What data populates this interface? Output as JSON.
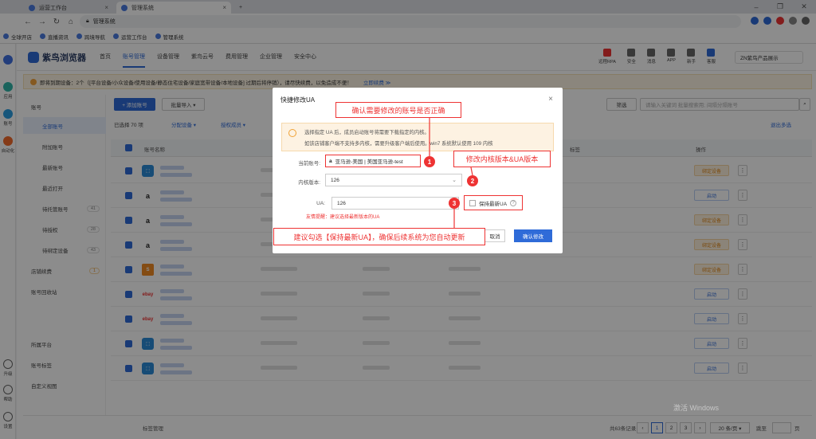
{
  "browser": {
    "tabs": [
      {
        "label": "运营工作台"
      },
      {
        "label": "管理系统"
      }
    ],
    "address": "管理系统",
    "bookmarks": [
      "全球开店",
      "直播资讯",
      "跨境导航",
      "运营工作台",
      "管理系统"
    ]
  },
  "leftrail": {
    "items": [
      "应用",
      "账号",
      "自动化",
      "升级",
      "帮助",
      "设置"
    ]
  },
  "app": {
    "brand": "紫鸟浏览器",
    "nav": [
      "首页",
      "账号管理",
      "设备管理",
      "紫鸟云号",
      "费用管理",
      "企业管理",
      "安全中心"
    ],
    "header_icons": [
      "远程RPA",
      "安全",
      "消息",
      "APP",
      "新手",
      "客服"
    ],
    "user": "ZN紫鸟产品展示"
  },
  "notice": {
    "text": "即将到期设备：2个（[平台设备/小众设备/使用设备/静态住宅设备/家庭宽带设备/本地设备] 过期后将停销），请尽快续费，以免造成不便！",
    "link": "立即续费 ≫"
  },
  "sidebar": {
    "section": "账号",
    "items": [
      {
        "label": "全部账号",
        "count": ""
      },
      {
        "label": "附加账号",
        "count": ""
      },
      {
        "label": "最新账号",
        "count": ""
      },
      {
        "label": "最近打开",
        "count": ""
      },
      {
        "label": "待托管账号",
        "count": "41"
      },
      {
        "label": "待授权",
        "count": "28"
      },
      {
        "label": "待绑定设备",
        "count": "43"
      }
    ],
    "extra": [
      "店铺续费",
      "账号回收站"
    ],
    "badge": "1",
    "bottom": [
      "所属平台",
      "账号标签",
      "自定义视图"
    ]
  },
  "main": {
    "add_btn": "+ 添加账号",
    "import_btn": "批量导入 ▾",
    "search_scope": "筛选",
    "search_placeholder": "请输入关键词 批量搜索用; 间隔分隔账号",
    "selected": "已选择 70 项",
    "dist_device": "分配设备 ▾",
    "auth_member": "授权成员 ▾",
    "exit_multi": "退出多选",
    "columns": [
      "账号名称",
      "标签",
      "操作"
    ],
    "rows": [
      {
        "icon": "⬚",
        "action": "绑定设备"
      },
      {
        "icon": "a",
        "action": "启动"
      },
      {
        "icon": "a",
        "action": "绑定设备"
      },
      {
        "icon": "a",
        "action": "绑定设备"
      },
      {
        "icon": "S",
        "action": "绑定设备"
      },
      {
        "icon": "ebay",
        "action": "启动"
      },
      {
        "icon": "ebay",
        "action": "启动"
      },
      {
        "icon": "⬚",
        "action": "启动"
      },
      {
        "icon": "⬚",
        "action": "启动"
      }
    ]
  },
  "footer": {
    "tag_manage": "标签管理",
    "total": "共63条记录",
    "pages": [
      "1",
      "2",
      "3"
    ],
    "page_size": "20 条/页 ▾",
    "goto": "跳至",
    "page_suffix": "页"
  },
  "modal": {
    "title": "快捷修改UA",
    "close": "×",
    "warn_line1": "选择指定 UA 后，成员启动账号将需要下载指定的内核。",
    "warn_line2": "如该店铺客户端不支持多内核，需要升级客户端后使用。win7 系统默认使用 109 内核",
    "account_label": "当前账号:",
    "account_value": "亚马逊-美国 | 美国亚马逊-test",
    "kernel_label": "内核版本:",
    "kernel_value": "126",
    "ua_label": "UA:",
    "ua_value": "126",
    "ua_error": "友情提醒：建议选择最新版本的UA",
    "keep_latest": "保持最新UA",
    "cancel": "取消",
    "confirm": "确认修改"
  },
  "annotations": {
    "callout1": "确认需要修改的账号是否正确",
    "callout2": "修改内核版本&UA版本",
    "callout3": "建议勾选【保持最新UA】，确保后续系统为您自动更新",
    "badge1": "1",
    "badge2": "2",
    "badge3": "3"
  },
  "watermark": "激活 Windows",
  "colors": {
    "primary": "#2f6bd8",
    "annotation": "#e33333",
    "warning": "#f3a23b"
  }
}
